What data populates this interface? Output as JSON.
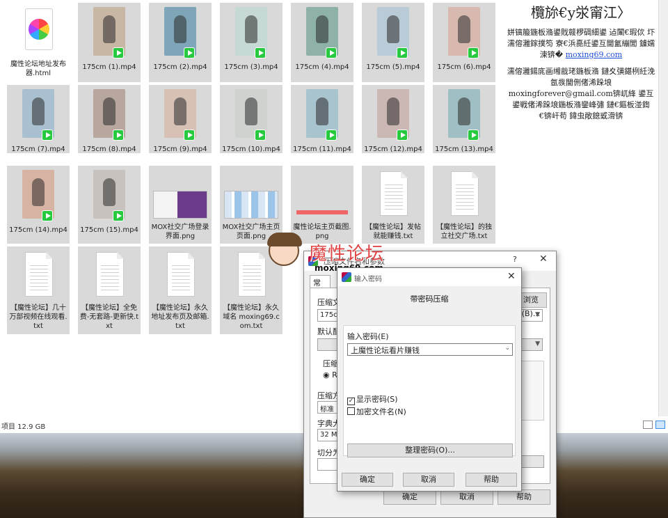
{
  "explorer": {
    "files": [
      {
        "name": "魔性论坛地址发布器.html",
        "kind": "html"
      },
      {
        "name": "175cm (1).mp4",
        "kind": "video",
        "color": "#c9b7a6"
      },
      {
        "name": "175cm (2).mp4",
        "kind": "video",
        "color": "#7fa6b8"
      },
      {
        "name": "175cm (3).mp4",
        "kind": "video",
        "color": "#c7d9d4"
      },
      {
        "name": "175cm (4).mp4",
        "kind": "video",
        "color": "#8fb2a8"
      },
      {
        "name": "175cm (5).mp4",
        "kind": "video",
        "color": "#b9cbd6"
      },
      {
        "name": "175cm (6).mp4",
        "kind": "video",
        "color": "#d8b9b0"
      },
      {
        "name": "175cm (7).mp4",
        "kind": "video",
        "color": "#a9c0d0"
      },
      {
        "name": "175cm (8).mp4",
        "kind": "video",
        "color": "#b7a79e"
      },
      {
        "name": "175cm (9).mp4",
        "kind": "video",
        "color": "#d7c1b5"
      },
      {
        "name": "175cm (10).mp4",
        "kind": "video",
        "color": "#cfd3d0"
      },
      {
        "name": "175cm (11).mp4",
        "kind": "video",
        "color": "#a8c4cf"
      },
      {
        "name": "175cm (12).mp4",
        "kind": "video",
        "color": "#cbb7b4"
      },
      {
        "name": "175cm (13).mp4",
        "kind": "video",
        "color": "#9fbfc4"
      },
      {
        "name": "175cm (14).mp4",
        "kind": "video",
        "color": "#d7b3a3"
      },
      {
        "name": "175cm (15).mp4",
        "kind": "video",
        "color": "#c7c2bd"
      },
      {
        "name": "MOX社交广场登录界面.png",
        "kind": "image",
        "style": "a"
      },
      {
        "name": "MOX社交广场主页页面.png",
        "kind": "image",
        "style": "b"
      },
      {
        "name": "魔性论坛主页截图.png",
        "kind": "image",
        "style": "c"
      },
      {
        "name": "【魔性论坛】发帖就能赚钱.txt",
        "kind": "doc"
      },
      {
        "name": "【魔性论坛】的独立社交广场.txt",
        "kind": "doc"
      },
      {
        "name": "【魔性论坛】几十万部视频在线观看.txt",
        "kind": "doc"
      },
      {
        "name": "【魔性论坛】全免费-无套路-更新快.txt",
        "kind": "doc"
      },
      {
        "name": "【魔性论坛】永久地址发布页及邮箱.txt",
        "kind": "doc"
      },
      {
        "name": "【魔性论坛】永久域名 moxing69.com.txt",
        "kind": "doc"
      }
    ],
    "status_text": "项目 12.9 GB"
  },
  "sidepanel": {
    "title": "欖旀€y泶甯江〉",
    "para1": "姘镐箙鍦板潃鍙戝竷椤碉細鍙 迠闈€瑕佽 圷濡傛灉鎵撲笉 寮€浜嗭紝鍙互閫氳繃閭 鐪嬬湅锛�",
    "link": "moxing69.com",
    "para2": "濡傛灉鍚庣画缃戠珯鍦板潃 鏈夊彉鍖栵紝浼氬彂閫侀偖浠跺埌 moxingforever@gmail.com锛屼綘 鍙互鍙戦偖浠跺埌鍦板潃鑾峰彇 鏈€鏂板湴鍧€锛屽苟 鍏虫敞鎴戜滑锛"
  },
  "watermark": {
    "title": "魔性论坛",
    "url": "moxing69.com"
  },
  "dialog_back": {
    "title": "压缩文件名和参数",
    "help": "?",
    "close": "✕",
    "tab": "常规",
    "archive_label": "压缩文",
    "archive_value": "175cm",
    "browse": "浏览(B)...",
    "profile_label": "默认配",
    "format_label": "压缩",
    "format_option": "RAR",
    "method_label": "压缩方",
    "method_value": "标准",
    "dict_label": "字典大",
    "dict_value": "32 MB",
    "split_label": "切分为",
    "ok": "确定",
    "cancel": "取消",
    "help_btn": "帮助"
  },
  "dialog_front": {
    "title": "输入密码",
    "close": "✕",
    "heading": "带密码压缩",
    "input_label": "输入密码(E)",
    "password_value": "上魔性论坛看片赚钱",
    "show_password": "显示密码(S)",
    "show_password_checked": true,
    "encrypt_names": "加密文件名(N)",
    "encrypt_names_checked": false,
    "organize": "整理密码(O)...",
    "ok": "确定",
    "cancel": "取消",
    "help": "帮助"
  }
}
